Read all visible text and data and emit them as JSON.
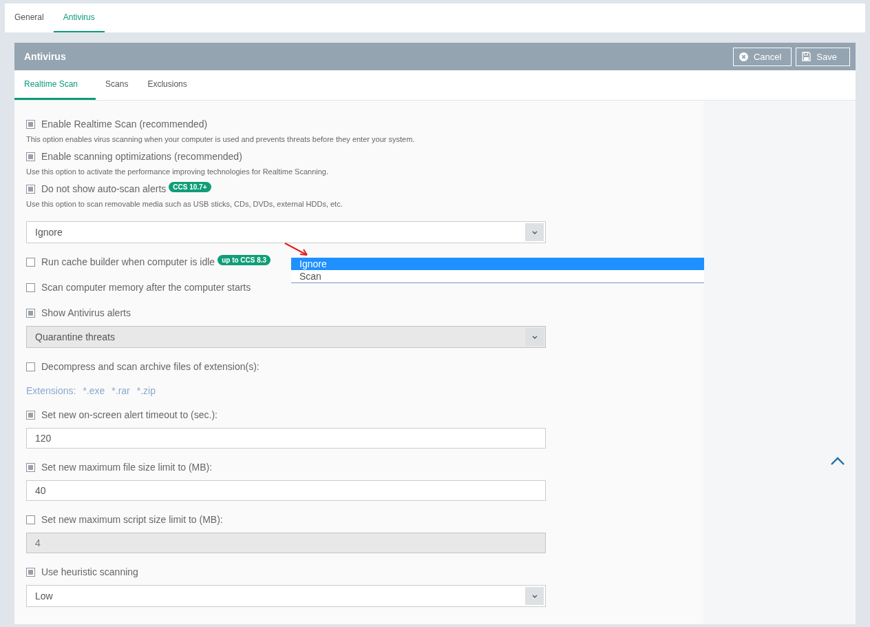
{
  "top_tabs": [
    {
      "label": "General",
      "selected": false
    },
    {
      "label": "Antivirus",
      "selected": true
    }
  ],
  "panel": {
    "title": "Antivirus",
    "buttons": [
      {
        "kind": "cancel",
        "label": "Cancel"
      },
      {
        "kind": "save",
        "label": "Save"
      }
    ]
  },
  "sub_tabs": [
    {
      "label": "Realtime Scan",
      "selected": true
    },
    {
      "label": "Scans",
      "selected": false
    },
    {
      "label": "Exclusions",
      "selected": false
    }
  ],
  "items": [
    {
      "kind": "checkbox",
      "label": "Enable Realtime Scan (recommended)",
      "checked": true
    },
    {
      "kind": "hint",
      "text": "This option enables virus scanning when your computer is used and prevents threats before they enter your system."
    },
    {
      "kind": "checkbox",
      "label": "Enable scanning optimizations (recommended)",
      "checked": true
    },
    {
      "kind": "hint",
      "text": "Use this option to activate the performance improving technologies for Realtime Scanning."
    },
    {
      "kind": "checkbox",
      "label": "Do not show auto-scan alerts",
      "checked": true,
      "badge": "CCS 10.7+"
    },
    {
      "kind": "hint",
      "text": "Use this option to scan removable media such as USB sticks, CDs, DVDs, external HDDs, etc."
    },
    {
      "kind": "select",
      "value": "Ignore",
      "disabled": false,
      "options": [
        {
          "label": "Ignore",
          "selected": true
        },
        {
          "label": "Scan",
          "selected": false
        }
      ]
    },
    {
      "kind": "checkbox",
      "label": "Run cache builder when computer is idle",
      "checked": false,
      "badge": "up to CCS 8.3"
    },
    {
      "kind": "checkbox",
      "label": "Scan computer memory after the computer starts",
      "checked": false
    },
    {
      "kind": "checkbox",
      "label": "Show Antivirus alerts",
      "checked": true
    },
    {
      "kind": "select",
      "value": "Quarantine threats",
      "disabled": true
    },
    {
      "kind": "checkbox",
      "label": "Decompress and scan archive files of extension(s):",
      "checked": false
    },
    {
      "kind": "extensions",
      "label": "Extensions:",
      "values": [
        "*.exe",
        "*.rar",
        "*.zip"
      ]
    },
    {
      "kind": "checkbox",
      "label": "Set new on-screen alert timeout to (sec.):",
      "checked": true
    },
    {
      "kind": "input",
      "value": "120",
      "disabled": false
    },
    {
      "kind": "checkbox",
      "label": "Set new maximum file size limit to (MB):",
      "checked": true
    },
    {
      "kind": "input",
      "value": "40",
      "disabled": false
    },
    {
      "kind": "checkbox",
      "label": "Set new maximum script size limit to (MB):",
      "checked": false
    },
    {
      "kind": "input",
      "value": "4",
      "disabled": true
    },
    {
      "kind": "checkbox",
      "label": "Use heuristic scanning",
      "checked": true
    },
    {
      "kind": "select",
      "value": "Low",
      "disabled": false
    }
  ]
}
